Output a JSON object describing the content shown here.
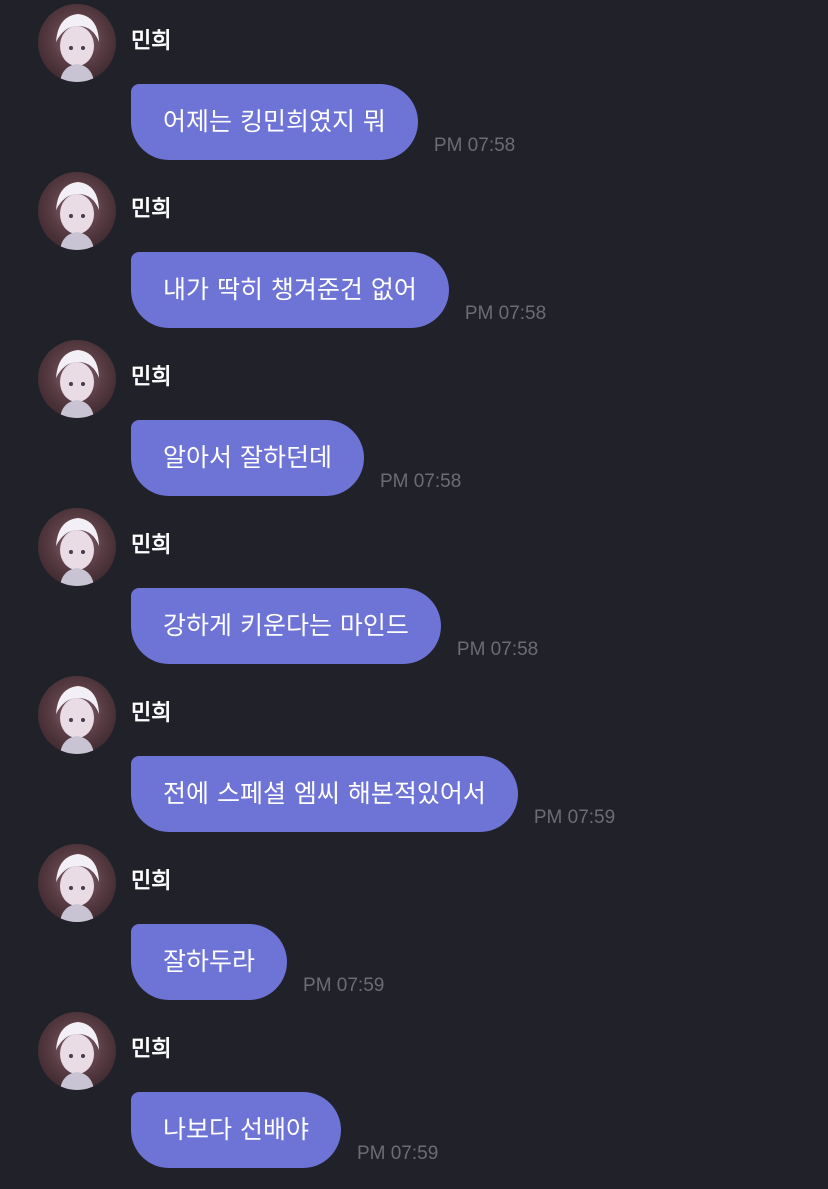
{
  "messages": [
    {
      "sender": "민희",
      "text": "어제는 킹민희였지 뭐",
      "time": "PM 07:58"
    },
    {
      "sender": "민희",
      "text": "내가 딱히 챙겨준건 없어",
      "time": "PM 07:58"
    },
    {
      "sender": "민희",
      "text": "알아서 잘하던데",
      "time": "PM 07:58"
    },
    {
      "sender": "민희",
      "text": "강하게 키운다는 마인드",
      "time": "PM 07:58"
    },
    {
      "sender": "민희",
      "text": "전에 스페셜 엠씨 해본적있어서",
      "time": "PM 07:59"
    },
    {
      "sender": "민희",
      "text": "잘하두라",
      "time": "PM 07:59"
    },
    {
      "sender": "민희",
      "text": "나보다 선배야",
      "time": "PM 07:59"
    }
  ],
  "avatar_icon": "profile-photo",
  "colors": {
    "background": "#212129",
    "bubble": "#6e73d6",
    "time": "#6c6c78",
    "sender": "#ffffff"
  }
}
